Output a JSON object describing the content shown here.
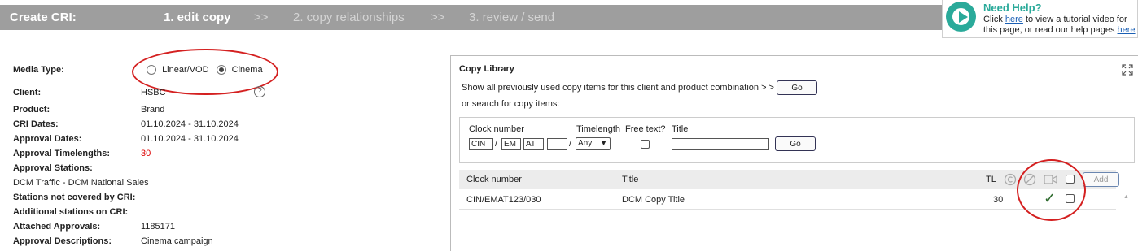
{
  "header": {
    "title": "Create CRI:",
    "steps": [
      "1. edit copy",
      ">>",
      "2. copy relationships",
      ">>",
      "3. review / send"
    ]
  },
  "help": {
    "title": "Need Help?",
    "line1_pre": "Click ",
    "link1": "here",
    "line1_post": " to view a tutorial video for",
    "line2_pre": "this page, or read our help pages ",
    "link2": "here"
  },
  "details": {
    "media_type_label": "Media Type:",
    "media_options": [
      "Linear/VOD",
      "Cinema"
    ],
    "media_selected": "Cinema",
    "client_label": "Client:",
    "client": "HSBC",
    "product_label": "Product:",
    "product": "Brand",
    "cri_dates_label": "CRI Dates:",
    "cri_dates": "01.10.2024 - 31.10.2024",
    "approval_dates_label": "Approval Dates:",
    "approval_dates": "01.10.2024 - 31.10.2024",
    "approval_timelengths_label": "Approval Timelengths:",
    "approval_timelengths": "30",
    "approval_stations_label": "Approval Stations:",
    "approval_stations": "DCM Traffic -  DCM National Sales",
    "stations_not_covered_label": "Stations not covered by CRI:",
    "additional_stations_label": "Additional stations on CRI:",
    "attached_approvals_label": "Attached Approvals:",
    "attached_approvals": "1185171",
    "approval_descriptions_label": "Approval Descriptions:",
    "approval_descriptions": "Cinema campaign"
  },
  "library": {
    "title": "Copy Library",
    "show_all_text": "Show all previously used copy items for this client and product combination > >",
    "go_label": "Go",
    "search_text": "or search for copy items:",
    "search": {
      "clock_number_label": "Clock number",
      "timelength_label": "Timelength",
      "free_text_label": "Free text?",
      "title_label": "Title",
      "clock_part1": "CIN",
      "clock_part2": "EM",
      "clock_part3": "AT",
      "clock_part4": "",
      "separator": "/",
      "timelength_value": "Any",
      "title_value": "",
      "go_label": "Go"
    },
    "table": {
      "headers": {
        "clock_number": "Clock number",
        "title": "Title",
        "tl": "TL"
      },
      "add_label": "Add",
      "rows": [
        {
          "clock_number": "CIN/EMAT123/030",
          "title": "DCM Copy Title",
          "tl": "30",
          "approved": "✓"
        }
      ]
    }
  },
  "colors": {
    "accent_red": "#d42020",
    "teal": "#2aaa9a",
    "header_gray": "#9e9e9e"
  }
}
